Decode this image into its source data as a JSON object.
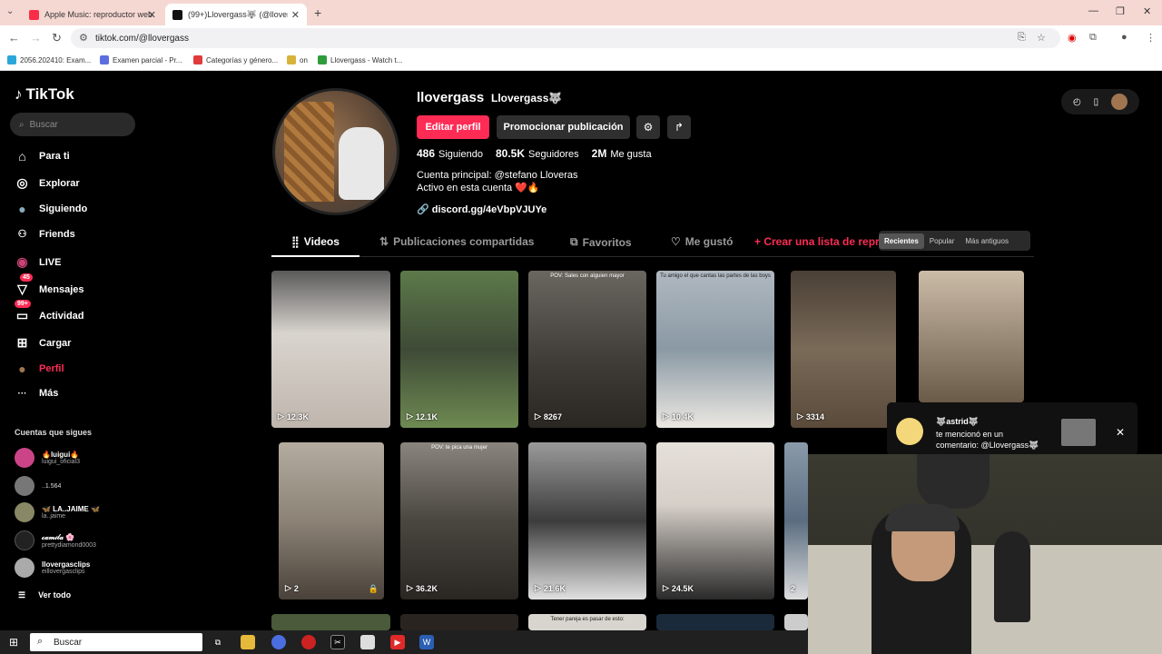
{
  "browser": {
    "tabs": [
      {
        "title": "Apple Music: reproductor web",
        "fav_color": "#fa2d48"
      },
      {
        "title": "(99+)Llovergass🐺 (@llovergass)",
        "fav_color": "#111111"
      }
    ],
    "url": "tiktok.com/@llovergass",
    "bookmarks": [
      {
        "label": "2056.202410: Exam...",
        "color": "#2aa7d8"
      },
      {
        "label": "Examen parcial - Pr...",
        "color": "#5b6ee1"
      },
      {
        "label": "Categorías y género...",
        "color": "#e03a3a"
      },
      {
        "label": "on",
        "color": "#d8b23a"
      },
      {
        "label": "Llovergass - Watch t...",
        "color": "#2e9c3d"
      }
    ]
  },
  "sidebar": {
    "logo": "TikTok",
    "search_placeholder": "Buscar",
    "items": [
      {
        "label": "Para ti",
        "icon": "home-icon",
        "glyph": "⌂"
      },
      {
        "label": "Explorar",
        "icon": "compass-icon",
        "glyph": "◎"
      },
      {
        "label": "Siguiendo",
        "icon": "following-avatar-icon",
        "glyph": "●"
      },
      {
        "label": "Friends",
        "icon": "friends-icon",
        "glyph": "👥"
      },
      {
        "label": "LIVE",
        "icon": "live-icon",
        "glyph": "◉"
      },
      {
        "label": "Mensajes",
        "icon": "messages-icon",
        "glyph": "▽",
        "badge": "45"
      },
      {
        "label": "Actividad",
        "icon": "activity-icon",
        "glyph": "▭",
        "badge": "99+"
      },
      {
        "label": "Cargar",
        "icon": "upload-icon",
        "glyph": "⊞"
      },
      {
        "label": "Perfil",
        "icon": "profile-avatar-icon",
        "glyph": "●"
      },
      {
        "label": "Más",
        "icon": "more-icon",
        "glyph": "···"
      }
    ],
    "following_title": "Cuentas que sigues",
    "following": [
      {
        "name": "🔥luigui🔥",
        "handle": "luigui_oficial3"
      },
      {
        "name": "..1.564",
        "handle": ""
      },
      {
        "name": "🦋 LA..JAIME 🦋",
        "handle": "la..jaime"
      },
      {
        "name": "𝒸𝒶𝓂𝒾𝓁𝒶 🌸",
        "handle": "prettydiamond0003"
      },
      {
        "name": "llovergasclips",
        "handle": "eillovergasclips"
      }
    ],
    "see_all": "Ver todo"
  },
  "profile": {
    "username": "llovergass",
    "nickname": "Llovergass🐺",
    "edit_button": "Editar perfil",
    "promote_button": "Promocionar publicación",
    "following_count": "486",
    "following_label": "Siguiendo",
    "followers_count": "80.5K",
    "followers_label": "Seguidores",
    "likes_count": "2M",
    "likes_label": "Me gusta",
    "bio_line1": "Cuenta principal: @stefano Lloveras",
    "bio_line2": "Activo en esta cuenta ❤️🔥",
    "link": "discord.gg/4eVbpVJUYe"
  },
  "tabs": {
    "videos": "Videos",
    "reposts": "Publicaciones compartidas",
    "favorites": "Favoritos",
    "liked": "Me gustó",
    "create_list": "+ Crear una lista de reproducción",
    "sort": [
      "Recientes",
      "Popular",
      "Más antiguos"
    ]
  },
  "videos_row1": [
    {
      "views": "12.3K",
      "caption": "",
      "color": "#d9d4ce"
    },
    {
      "views": "12.1K",
      "caption": "",
      "color": "#4c6b3f"
    },
    {
      "views": "8267",
      "caption": "POV: Sales con alguien mayor",
      "color": "#3e3a36"
    },
    {
      "views": "10.4K",
      "caption": "Tu amigo el que cantas las partes de las boys",
      "color": "#8a99a4"
    },
    {
      "views": "3314",
      "caption": "",
      "color": "#7a6a58"
    },
    {
      "views": "",
      "caption": "",
      "color": "#9a8a78"
    }
  ],
  "videos_row2": [
    {
      "views": "2",
      "caption": "",
      "color": "#8c8276"
    },
    {
      "views": "36.2K",
      "caption": "POV: te pica una mujer",
      "color": "#4a4640"
    },
    {
      "views": "21.6K",
      "caption": "",
      "color": "#3c3c3c"
    },
    {
      "views": "24.5K",
      "caption": "",
      "color": "#d6cfc8"
    },
    {
      "views": "2",
      "caption": "",
      "color": "#5a6d80"
    }
  ],
  "videos_row3_caption": "Tener pareja es pasar de esto:",
  "notification": {
    "name": "🐺astrid🐺",
    "text": "te mencionó en un comentario: @Llovergass🐺"
  },
  "taskbar": {
    "search": "Buscar"
  }
}
